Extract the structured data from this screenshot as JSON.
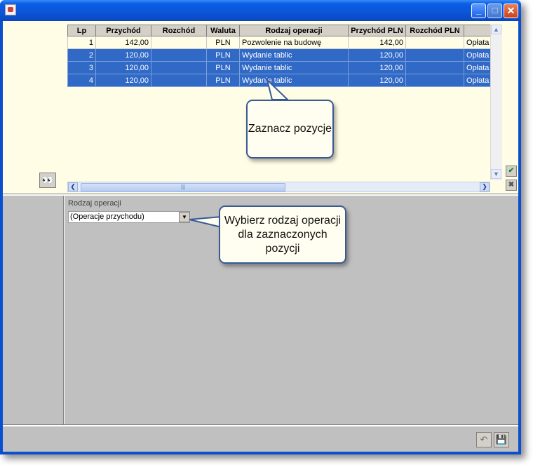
{
  "window": {
    "minimize_glyph": "_",
    "maximize_glyph": "□",
    "close_glyph": "✕"
  },
  "table": {
    "columns": [
      "Lp",
      "Przychód",
      "Rozchód",
      "Waluta",
      "Rodzaj operacji",
      "Przychód PLN",
      "Rozchód PLN",
      ""
    ],
    "rows": [
      {
        "lp": "1",
        "przychod": "142,00",
        "rozchod": "",
        "waluta": "PLN",
        "rodzaj": "Pozwolenie na budowę",
        "przychod_pln": "142,00",
        "rozchod_pln": "",
        "opis": "Opłata",
        "selected": false
      },
      {
        "lp": "2",
        "przychod": "120,00",
        "rozchod": "",
        "waluta": "PLN",
        "rodzaj": "Wydanie tablic",
        "przychod_pln": "120,00",
        "rozchod_pln": "",
        "opis": "Opłata",
        "selected": true
      },
      {
        "lp": "3",
        "przychod": "120,00",
        "rozchod": "",
        "waluta": "PLN",
        "rodzaj": "Wydanie tablic",
        "przychod_pln": "120,00",
        "rozchod_pln": "",
        "opis": "Opłata",
        "selected": true
      },
      {
        "lp": "4",
        "przychod": "120,00",
        "rozchod": "",
        "waluta": "PLN",
        "rodzaj": "Wydanie tablic",
        "przychod_pln": "120,00",
        "rozchod_pln": "",
        "opis": "Opłata",
        "selected": true
      }
    ]
  },
  "scroll": {
    "up": "▲",
    "down": "▼",
    "left": "❮",
    "right": "❯",
    "grip": "|||"
  },
  "side_buttons": {
    "binoculars_glyph": "👀",
    "ok_glyph": "✔",
    "cancel_glyph": "✖"
  },
  "form": {
    "label": "Rodzaj operacji",
    "value": "(Operacje przychodu)",
    "arrow": "▼"
  },
  "footer": {
    "undo_glyph": "↶",
    "save_glyph": "💾"
  },
  "callouts": {
    "select_rows": "Zaznacz pozycje",
    "choose_operation": "Wybierz rodzaj operacji dla zaznaczonych pozycji"
  },
  "colors": {
    "selection": "#3169c6",
    "grid_background": "#fffde6",
    "panel": "#c0c0c0",
    "title_bar": "#0b55d8"
  },
  "icons": {
    "app": "app-icon",
    "binoculars": "binoculars-icon",
    "ok": "checkmark-icon",
    "cancel": "cross-icon",
    "undo": "undo-icon",
    "save": "floppy-disk-icon"
  }
}
